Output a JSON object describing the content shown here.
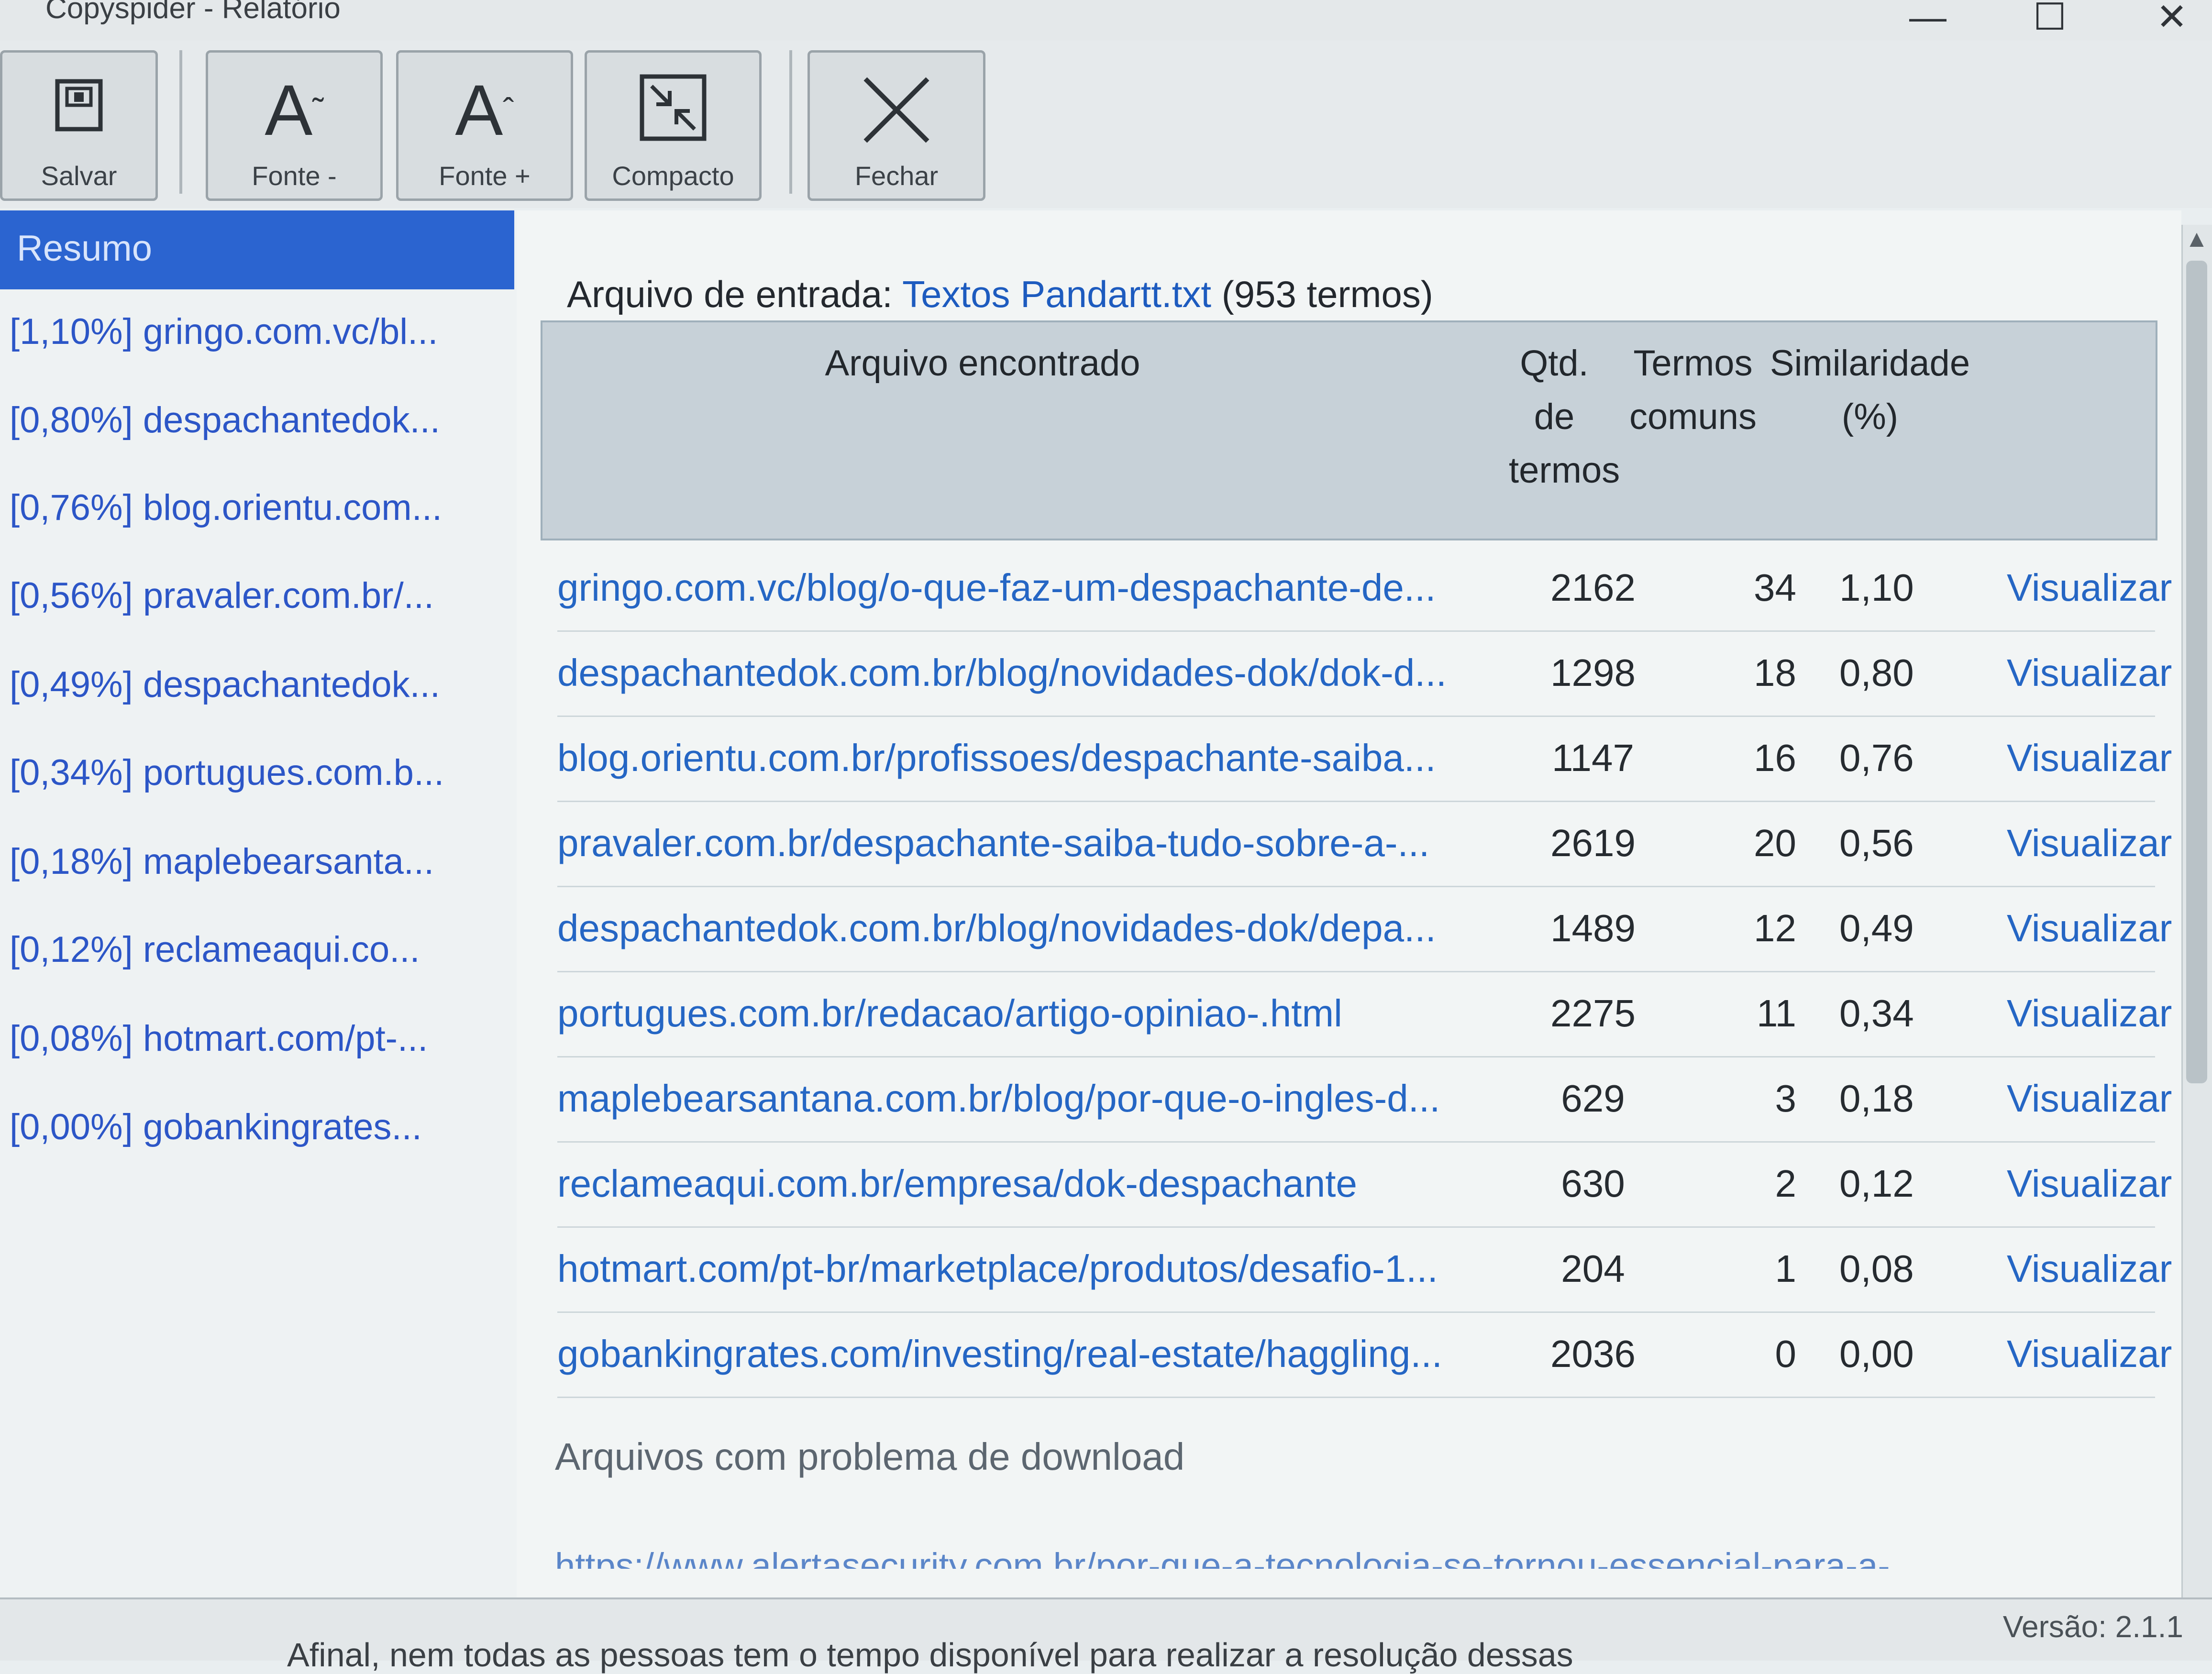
{
  "window": {
    "title": "Copyspider - Relatório",
    "minimize": "—",
    "maximize": "☐",
    "close": "✕"
  },
  "toolbar": {
    "save": "Salvar",
    "font_minus": "Fonte -",
    "font_plus": "Fonte +",
    "compact": "Compacto",
    "close": "Fechar"
  },
  "sidebar": {
    "header": "Resumo",
    "items": [
      {
        "label": "[1,10%] gringo.com.vc/bl..."
      },
      {
        "label": "[0,80%] despachantedok..."
      },
      {
        "label": "[0,76%] blog.orientu.com..."
      },
      {
        "label": "[0,56%] pravaler.com.br/..."
      },
      {
        "label": "[0,49%] despachantedok..."
      },
      {
        "label": "[0,34%] portugues.com.b..."
      },
      {
        "label": "[0,18%] maplebearsanta..."
      },
      {
        "label": "[0,12%] reclameaqui.co..."
      },
      {
        "label": "[0,08%] hotmart.com/pt-..."
      },
      {
        "label": "[0,00%] gobankingrates..."
      }
    ]
  },
  "main": {
    "input_label": "Arquivo de entrada: ",
    "input_file": "Textos Pandartt.txt",
    "input_terms": " (953 termos)",
    "columns": {
      "file": "Arquivo encontrado",
      "qtd": "Qtd. de termos",
      "common": "Termos comuns",
      "similarity": "Similaridade (%)"
    },
    "rows": [
      {
        "file": "gringo.com.vc/blog/o-que-faz-um-despachante-de...",
        "qtd": "2162",
        "common": "34",
        "sim": "1,10",
        "action": "Visualizar"
      },
      {
        "file": "despachantedok.com.br/blog/novidades-dok/dok-d...",
        "qtd": "1298",
        "common": "18",
        "sim": "0,80",
        "action": "Visualizar"
      },
      {
        "file": "blog.orientu.com.br/profissoes/despachante-saiba...",
        "qtd": "1147",
        "common": "16",
        "sim": "0,76",
        "action": "Visualizar"
      },
      {
        "file": "pravaler.com.br/despachante-saiba-tudo-sobre-a-...",
        "qtd": "2619",
        "common": "20",
        "sim": "0,56",
        "action": "Visualizar"
      },
      {
        "file": "despachantedok.com.br/blog/novidades-dok/depa...",
        "qtd": "1489",
        "common": "12",
        "sim": "0,49",
        "action": "Visualizar"
      },
      {
        "file": "portugues.com.br/redacao/artigo-opiniao-.html",
        "qtd": "2275",
        "common": "11",
        "sim": "0,34",
        "action": "Visualizar"
      },
      {
        "file": "maplebearsantana.com.br/blog/por-que-o-ingles-d...",
        "qtd": "629",
        "common": "3",
        "sim": "0,18",
        "action": "Visualizar"
      },
      {
        "file": "reclameaqui.com.br/empresa/dok-despachante",
        "qtd": "630",
        "common": "2",
        "sim": "0,12",
        "action": "Visualizar"
      },
      {
        "file": "hotmart.com/pt-br/marketplace/produtos/desafio-1...",
        "qtd": "204",
        "common": "1",
        "sim": "0,08",
        "action": "Visualizar"
      },
      {
        "file": "gobankingrates.com/investing/real-estate/haggling...",
        "qtd": "2036",
        "common": "0",
        "sim": "0,00",
        "action": "Visualizar"
      }
    ],
    "problem_label": "Arquivos com problema de download",
    "problem_url": "https://www.alertasecurity.com.br/por-que-a-tecnologia-se-tornou-essencial-para-a-"
  },
  "status": {
    "version": "Versão: 2.1.1"
  },
  "background_text": "Afinal, nem todas as pessoas tem o tempo disponível para realizar a resolução dessas"
}
